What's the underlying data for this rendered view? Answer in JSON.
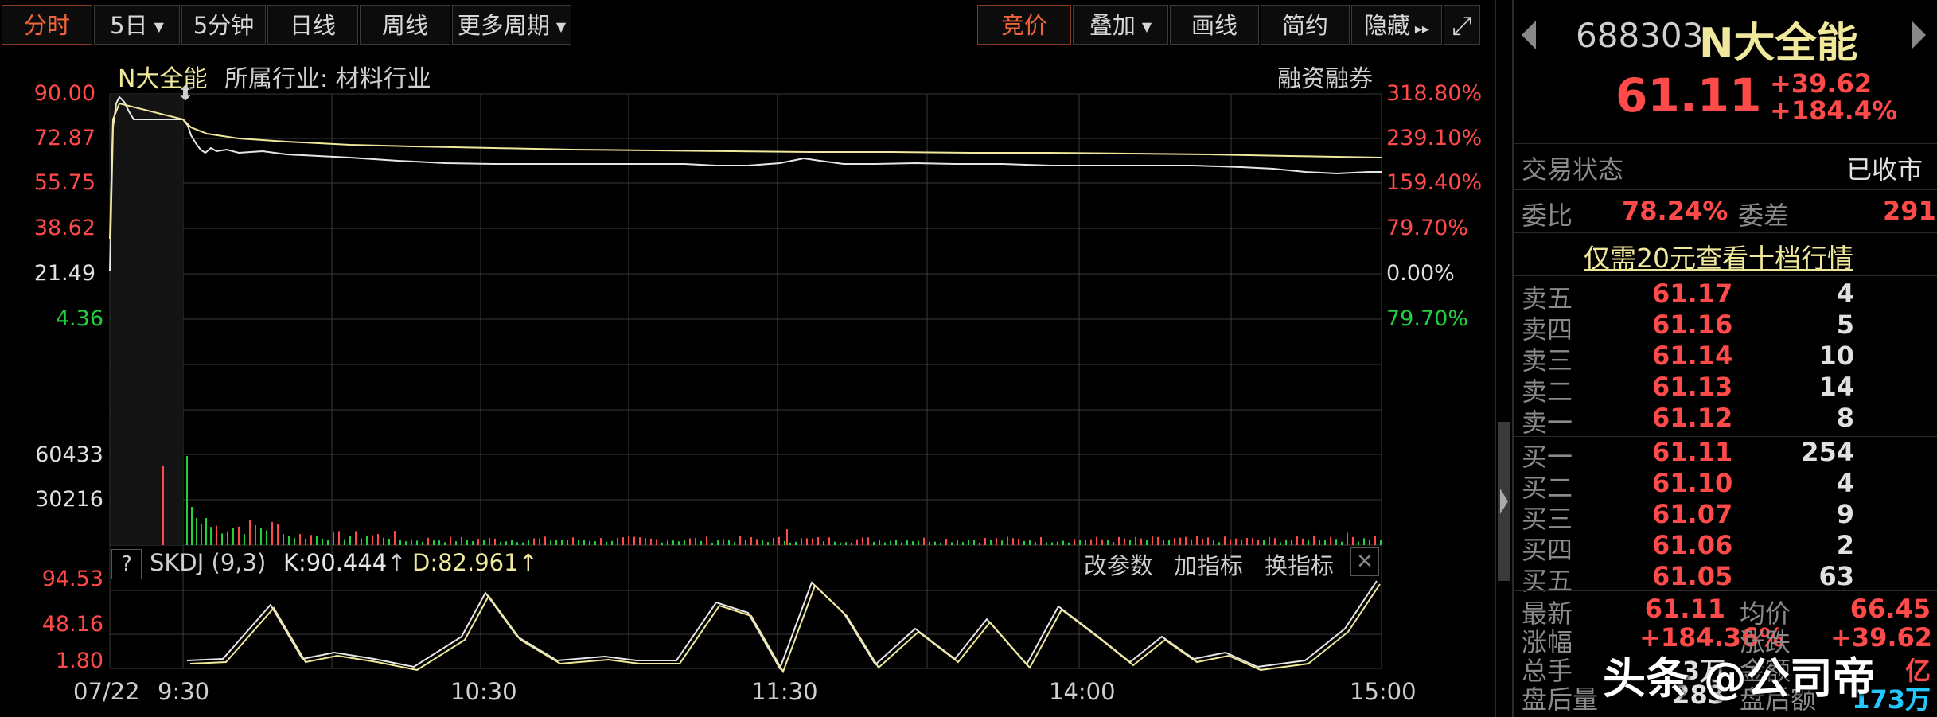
{
  "toolbar": {
    "items": [
      {
        "label": "分时",
        "active": true
      },
      {
        "label": "5日",
        "caret": true
      },
      {
        "label": "5分钟"
      },
      {
        "label": "日线"
      },
      {
        "label": "周线"
      },
      {
        "label": "更多周期",
        "caret": true
      }
    ],
    "right_items": [
      {
        "label": "竞价",
        "active": true
      },
      {
        "label": "叠加",
        "caret": true
      },
      {
        "label": "画线"
      },
      {
        "label": "简约"
      },
      {
        "label": "隐藏"
      }
    ],
    "hide_icon": "fast-forward-icon",
    "fullscreen_icon": "fullscreen-icon"
  },
  "chart_header": {
    "name": "N大全能",
    "industry": "所属行业: 材料行业",
    "margin": "融资融券"
  },
  "price_axis": {
    "left_labels": [
      "90.00",
      "72.87",
      "55.75",
      "38.62",
      "21.49",
      "4.36"
    ],
    "right_labels": [
      "318.80%",
      "239.10%",
      "159.40%",
      "79.70%",
      "0.00%",
      "79.70%"
    ],
    "colors": {
      "up": "#ff4a4a",
      "down": "#22d13d",
      "flat": "#e0e0e0"
    }
  },
  "volume_axis": {
    "labels": [
      "60433",
      "30216"
    ]
  },
  "indicator": {
    "help": "?",
    "name": "SKDJ (9,3)",
    "k_label": "K:90.444",
    "d_label": "D:82.961",
    "arrow_k": "↑",
    "arrow_d": "↑",
    "buttons": [
      "改参数",
      "加指标",
      "换指标"
    ],
    "close_icon": "close-icon",
    "axis_labels": [
      "94.53",
      "48.16",
      "1.80"
    ]
  },
  "time_axis": {
    "labels": [
      "07/22",
      "9:30",
      "10:30",
      "11:30",
      "14:00",
      "15:00"
    ]
  },
  "quote": {
    "code": "688303",
    "name": "N大全能",
    "price": "61.11",
    "change": "+39.62",
    "change_pct": "+184.4%",
    "prev_icon": "triangle-left-icon",
    "next_icon": "triangle-right-icon"
  },
  "status": {
    "label": "交易状态",
    "value": "已收市"
  },
  "commission": {
    "ratio_label": "委比",
    "ratio_value": "78.24%",
    "diff_label": "委差",
    "diff_value": "291"
  },
  "promo": "仅需20元查看十档行情",
  "order_book": {
    "asks": [
      {
        "label": "卖五",
        "price": "61.17",
        "vol": "4"
      },
      {
        "label": "卖四",
        "price": "61.16",
        "vol": "5"
      },
      {
        "label": "卖三",
        "price": "61.14",
        "vol": "10"
      },
      {
        "label": "卖二",
        "price": "61.13",
        "vol": "14"
      },
      {
        "label": "卖一",
        "price": "61.12",
        "vol": "8"
      }
    ],
    "bids": [
      {
        "label": "买一",
        "price": "61.11",
        "vol": "254"
      },
      {
        "label": "买二",
        "price": "61.10",
        "vol": "4"
      },
      {
        "label": "买三",
        "price": "61.07",
        "vol": "9"
      },
      {
        "label": "买四",
        "price": "61.06",
        "vol": "2"
      },
      {
        "label": "买五",
        "price": "61.05",
        "vol": "63"
      }
    ]
  },
  "stats": [
    {
      "l1": "最新",
      "v1": "61.11",
      "l2": "均价",
      "v2": "66.45"
    },
    {
      "l1": "涨幅",
      "v1": "+184.36%",
      "l2": "涨跌",
      "v2": "+39.62"
    },
    {
      "l1": "总手",
      "v1": "3万",
      "l2": "金额",
      "v2": "亿"
    },
    {
      "l1": "盘后量",
      "v1": "283",
      "l2": "盘后额",
      "v2": "173万"
    }
  ],
  "watermark": "头条 @公司帝"
}
